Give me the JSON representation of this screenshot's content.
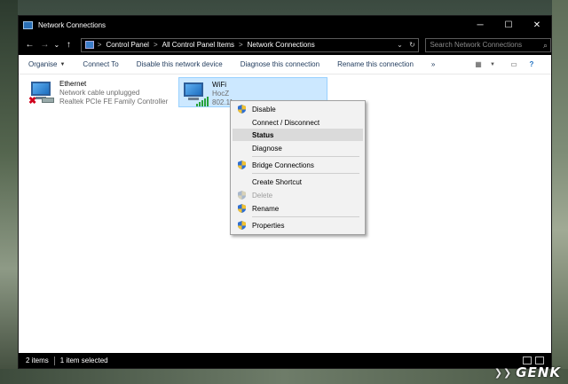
{
  "window": {
    "title": "Network Connections",
    "controls": {
      "minimize": "─",
      "maximize": "☐",
      "close": "✕"
    }
  },
  "address_bar": {
    "back": "←",
    "forward": "→",
    "recent": "⌄",
    "up": "↑",
    "crumbs": [
      "Control Panel",
      "All Control Panel Items",
      "Network Connections"
    ],
    "separator": ">",
    "dropdown": "⌄",
    "refresh": "↻",
    "search_placeholder": "Search Network Connections",
    "search_icon": "search-icon"
  },
  "toolbar": {
    "organise": "Organise",
    "connect_to": "Connect To",
    "disable": "Disable this network device",
    "diagnose": "Diagnose this connection",
    "rename": "Rename this connection",
    "more": "»"
  },
  "adapters": [
    {
      "name": "Ethernet",
      "status": "Network cable unplugged",
      "device": "Realtek PCIe FE Family Controller",
      "icon": "ethernet-adapter-icon"
    },
    {
      "name": "WiFi",
      "status": "HocZ",
      "device": "802.11",
      "icon": "wifi-adapter-icon",
      "selected": true
    }
  ],
  "context_menu": {
    "items": [
      {
        "label": "Disable",
        "shield": true
      },
      {
        "label": "Connect / Disconnect",
        "shield": false
      },
      {
        "label": "Status",
        "shield": false,
        "bold": true,
        "highlighted": true
      },
      {
        "label": "Diagnose",
        "shield": false
      },
      {
        "label": "Bridge Connections",
        "shield": true
      },
      {
        "label": "Create Shortcut",
        "shield": false
      },
      {
        "label": "Delete",
        "shield": true,
        "disabled": true
      },
      {
        "label": "Rename",
        "shield": true
      },
      {
        "label": "Properties",
        "shield": true
      }
    ]
  },
  "status_bar": {
    "items_count": "2 items",
    "selected": "1 item selected"
  },
  "watermark": {
    "text": "GENK"
  },
  "colors": {
    "titlebar": "#000000",
    "selection": "#cce8ff",
    "toolbar_text": "#1e395b",
    "menu_bg": "#f2f2f2"
  }
}
